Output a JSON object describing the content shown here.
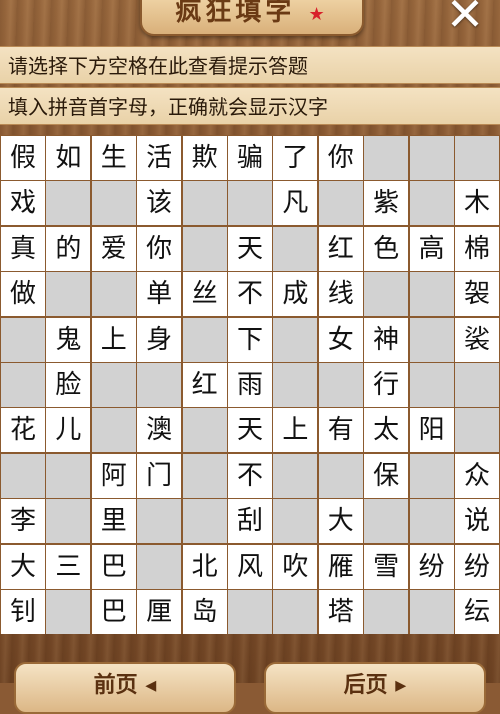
{
  "header": {
    "title": "疯狂填字",
    "close_symbol": "✕"
  },
  "hints": [
    "请选择下方空格在此查看提示答题",
    "填入拼音首字母，正确就会显示汉字"
  ],
  "grid": [
    [
      "假",
      "如",
      "生",
      "活",
      "欺",
      "骗",
      "了",
      "你",
      "",
      "",
      ""
    ],
    [
      "戏",
      "",
      "",
      "该",
      "",
      "",
      "凡",
      "",
      "紫",
      "",
      "木"
    ],
    [
      "真",
      "的",
      "爱",
      "你",
      "",
      "天",
      "",
      "红",
      "色",
      "高",
      "棉"
    ],
    [
      "做",
      "",
      "",
      "单",
      "丝",
      "不",
      "成",
      "线",
      "",
      "",
      "袈"
    ],
    [
      "",
      "鬼",
      "上",
      "身",
      "",
      "下",
      "",
      "女",
      "神",
      "",
      "裟"
    ],
    [
      "",
      "脸",
      "",
      "",
      "红",
      "雨",
      "",
      "",
      "行",
      "",
      ""
    ],
    [
      "花",
      "儿",
      "",
      "澳",
      "",
      "天",
      "上",
      "有",
      "太",
      "阳",
      ""
    ],
    [
      "",
      "",
      "阿",
      "门",
      "",
      "不",
      "",
      "",
      "保",
      "",
      "众"
    ],
    [
      "李",
      "",
      "里",
      "",
      "",
      "刮",
      "",
      "大",
      "",
      "",
      "说"
    ],
    [
      "大",
      "三",
      "巴",
      "",
      "北",
      "风",
      "吹",
      "雁",
      "雪",
      "纷",
      "纷"
    ],
    [
      "钊",
      "",
      "巴",
      "厘",
      "岛",
      "",
      "",
      "塔",
      "",
      "",
      "纭"
    ]
  ],
  "buttons": {
    "prev": "前页 ◂",
    "next": "后页 ▸"
  }
}
